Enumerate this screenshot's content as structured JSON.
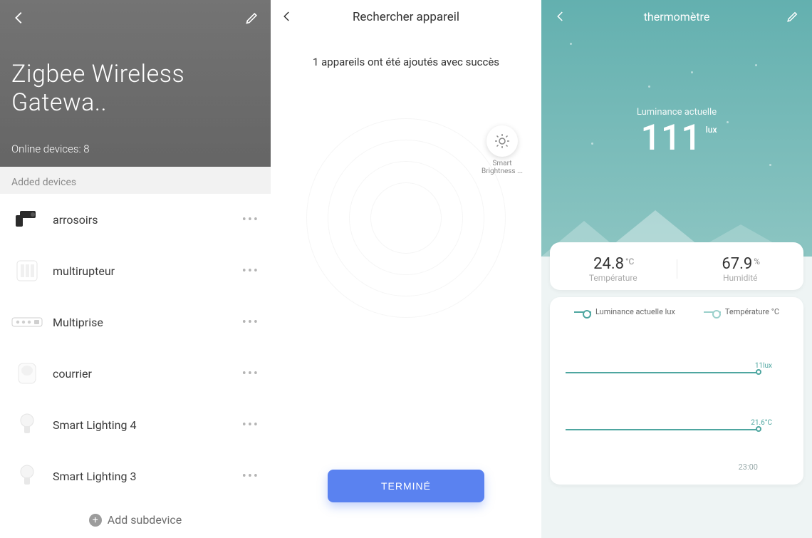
{
  "screen1": {
    "title": "Zigbee Wireless Gatewa..",
    "online_devices_label": "Online devices: 8",
    "section_header": "Added devices",
    "add_subdevice_label": "Add subdevice",
    "devices": [
      {
        "name": "arrosoirs",
        "icon": "irrigation-valve-icon"
      },
      {
        "name": "multirupteur",
        "icon": "switch-panel-icon"
      },
      {
        "name": "Multiprise",
        "icon": "power-strip-icon"
      },
      {
        "name": "courrier",
        "icon": "motion-sensor-icon"
      },
      {
        "name": "Smart Lighting 4",
        "icon": "bulb-icon"
      },
      {
        "name": "Smart Lighting 3",
        "icon": "bulb-icon"
      }
    ]
  },
  "screen2": {
    "title": "Rechercher appareil",
    "status_message": "1 appareils ont été ajoutés avec succès",
    "found_device_name": "Smart Brightness ...",
    "done_button": "TERMINÉ"
  },
  "screen3": {
    "title": "thermomètre",
    "luminance_label": "Luminance actuelle",
    "luminance_value": "111",
    "luminance_unit": "lux",
    "temperature_value": "24.8",
    "temperature_unit": "°C",
    "temperature_label": "Température",
    "humidity_value": "67.9",
    "humidity_unit": "%",
    "humidity_label": "Humidité",
    "legend_luminance": "Luminance actuelle lux",
    "legend_temperature": "Température °C",
    "chart_ann1": "11lux",
    "chart_ann2": "21.6°C",
    "chart_time": "23:00",
    "colors": {
      "teal": "#4ea6a0",
      "teal_soft": "#9ad0cb"
    }
  },
  "chart_data": {
    "type": "line",
    "x": [
      "23:00"
    ],
    "series": [
      {
        "name": "Luminance actuelle lux",
        "values": [
          11
        ],
        "color": "#4ea6a0"
      },
      {
        "name": "Température °C",
        "values": [
          21.6
        ],
        "color": "#9ad0cb"
      }
    ],
    "xlabel": "",
    "ylabel": ""
  }
}
